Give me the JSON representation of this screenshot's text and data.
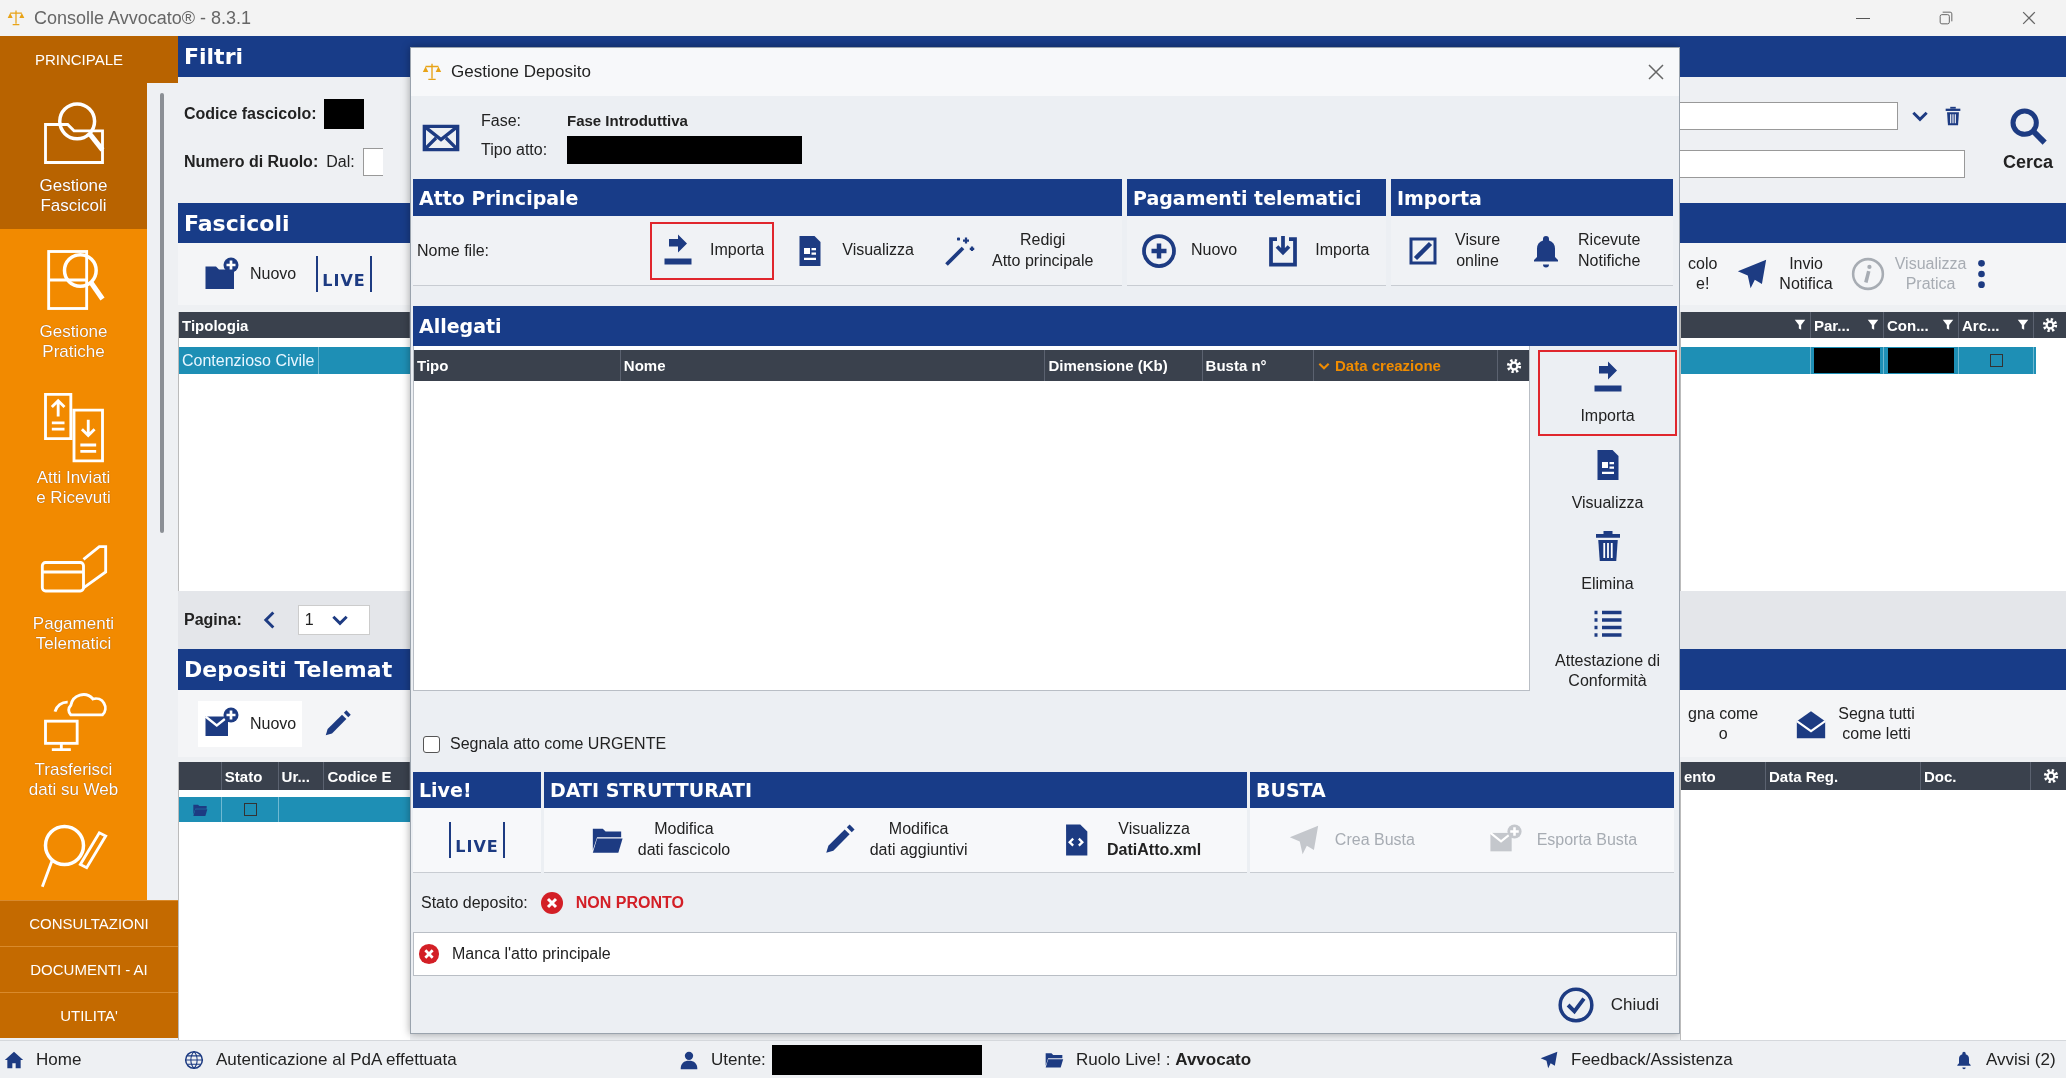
{
  "window": {
    "title": "Consolle Avvocato® - 8.3.1"
  },
  "sidebar": {
    "header": "PRINCIPALE",
    "items": [
      {
        "label": "Gestione\nFascicoli",
        "selected": true
      },
      {
        "label": "Gestione\nPratiche",
        "selected": false
      },
      {
        "label": "Atti Inviati\ne Ricevuti",
        "selected": false
      },
      {
        "label": "Pagamenti\nTelematici",
        "selected": false
      },
      {
        "label": "Trasferisci\ndati su Web",
        "selected": false
      },
      {
        "selected": false
      }
    ],
    "sections": [
      {
        "label": "CONSULTAZIONI"
      },
      {
        "label": "DOCUMENTI - AI"
      },
      {
        "label": "UTILITA'"
      }
    ]
  },
  "filters": {
    "title": "Filtri",
    "code_label": "Codice fascicolo:",
    "role_label": "Numero di Ruolo:",
    "from_label": "Dal:",
    "search_button": "Cerca"
  },
  "fascicoli": {
    "title": "Fascicoli",
    "toolbar": [
      {
        "label": "Nuovo"
      }
    ],
    "live_logo": "LIVE",
    "right_toolbar": [
      {
        "label": "colo\ne!",
        "disabled": false
      },
      {
        "label": "Invio\nNotifica",
        "disabled": false
      },
      {
        "label": "Visualizza\nPratica",
        "disabled": true
      }
    ],
    "left_columns": [
      {
        "label": "Tipologia"
      }
    ],
    "right_columns": [
      {},
      {
        "label": "Par..."
      },
      {
        "label": "Con..."
      },
      {
        "label": "Arc..."
      }
    ],
    "rows": [
      {
        "selected": true,
        "left_cells": [
          "Contenzioso Civile"
        ],
        "right_cells": [
          {
            "kind": "blank"
          },
          {
            "kind": "redacted"
          },
          {
            "kind": "redacted"
          },
          {
            "kind": "checkbox",
            "checked": false
          }
        ]
      }
    ]
  },
  "pagination": {
    "label": "Pagina:",
    "page": "1"
  },
  "depositi": {
    "title": "Depositi Telemat",
    "toolbar": [
      {
        "label": "Nuovo"
      }
    ],
    "right_toolbar": [
      {
        "label": "gna come\no"
      },
      {
        "label": "Segna tutti\ncome letti"
      }
    ],
    "left_columns": [
      {
        "label": "Stato"
      },
      {
        "label": "Ur..."
      },
      {
        "label": "Codice E"
      }
    ],
    "right_columns": [
      {
        "label": "ento"
      },
      {
        "label": "Data Reg."
      },
      {
        "label": "Doc."
      }
    ],
    "rows": [
      {
        "selected": true,
        "checked": false
      }
    ]
  },
  "dialog": {
    "title": "Gestione Deposito",
    "phase_label": "Fase:",
    "phase_value": "Fase Introduttiva",
    "act_type_label": "Tipo atto:",
    "top_groups": [
      {
        "title": "Atto Principale",
        "label": "Nome file:",
        "actions": [
          {
            "label": "Importa",
            "highlighted": true
          },
          {
            "label": "Visualizza",
            "highlighted": false
          },
          {
            "label": "Redigi\nAtto principale",
            "highlighted": false
          }
        ]
      },
      {
        "title": "Pagamenti telematici",
        "actions": [
          {
            "label": "Nuovo",
            "highlighted": false
          },
          {
            "label": "Importa",
            "highlighted": false
          }
        ]
      },
      {
        "title": "Importa",
        "actions": [
          {
            "label": "Visure\nonline",
            "highlighted": false
          },
          {
            "label": "Ricevute\nNotifiche",
            "highlighted": false
          }
        ]
      }
    ],
    "attachments": {
      "title": "Allegati",
      "columns": [
        {
          "label": "Tipo",
          "sorted": false
        },
        {
          "label": "Nome",
          "sorted": false
        },
        {
          "label": "Dimensione (Kb)",
          "sorted": false
        },
        {
          "label": "Busta n°",
          "sorted": false
        },
        {
          "label": "Data creazione",
          "sorted": true
        }
      ],
      "side_actions": [
        {
          "label": "Importa",
          "highlighted": true
        },
        {
          "label": "Visualizza",
          "highlighted": false
        },
        {
          "label": "Elimina",
          "highlighted": false
        },
        {
          "label": "Attestazione di\nConformità",
          "highlighted": false
        }
      ]
    },
    "urgent": {
      "label": "Segnala atto come URGENTE",
      "checked": false
    },
    "bottom_groups": [
      {
        "title": "Live!",
        "live_logo": "LIVE"
      },
      {
        "title": "DATI STRUTTURATI",
        "actions": [
          {
            "label": "Modifica\ndati fascicolo",
            "disabled": false
          },
          {
            "label": "Modifica\ndati aggiuntivi",
            "disabled": false
          },
          {
            "label": "Visualizza\n**DatiAtto.xml**",
            "disabled": false
          }
        ]
      },
      {
        "title": "BUSTA",
        "actions": [
          {
            "label": "Crea Busta",
            "disabled": true
          },
          {
            "label": "Esporta Busta",
            "disabled": true
          }
        ]
      }
    ],
    "status": {
      "label": "Stato deposito:",
      "value": "NON PRONTO"
    },
    "messages": [
      {
        "text": "Manca l'atto principale"
      }
    ],
    "close_button": "Chiudi"
  },
  "status_bar": {
    "items": [
      {
        "label": "Home"
      },
      {
        "label": "Autenticazione al PdA effettuata"
      },
      {
        "label": "Utente:",
        "redacted": true
      },
      {
        "label": "Ruolo Live! : **Avvocato**"
      },
      {
        "label": "Feedback/Assistenza"
      },
      {
        "label": "Avvisi (2)"
      }
    ]
  }
}
